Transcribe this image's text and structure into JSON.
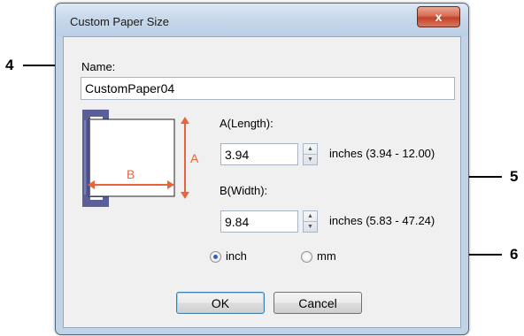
{
  "dialog": {
    "title": "Custom Paper Size",
    "close_label": "x"
  },
  "name": {
    "label": "Name:",
    "value": "CustomPaper04"
  },
  "length": {
    "label": "A(Length):",
    "value": "3.94",
    "range": "inches (3.94 - 12.00)"
  },
  "width": {
    "label": "B(Width):",
    "value": "9.84",
    "range": "inches (5.83 - 47.24)"
  },
  "units": {
    "options": [
      "inch",
      "mm"
    ],
    "selected": "inch"
  },
  "illustration": {
    "label_a": "A",
    "label_b": "B",
    "accent_color": "#e8643a",
    "tray_color": "#5a5f9a"
  },
  "buttons": {
    "ok": "OK",
    "cancel": "Cancel"
  },
  "callouts": [
    "4",
    "5",
    "6"
  ]
}
